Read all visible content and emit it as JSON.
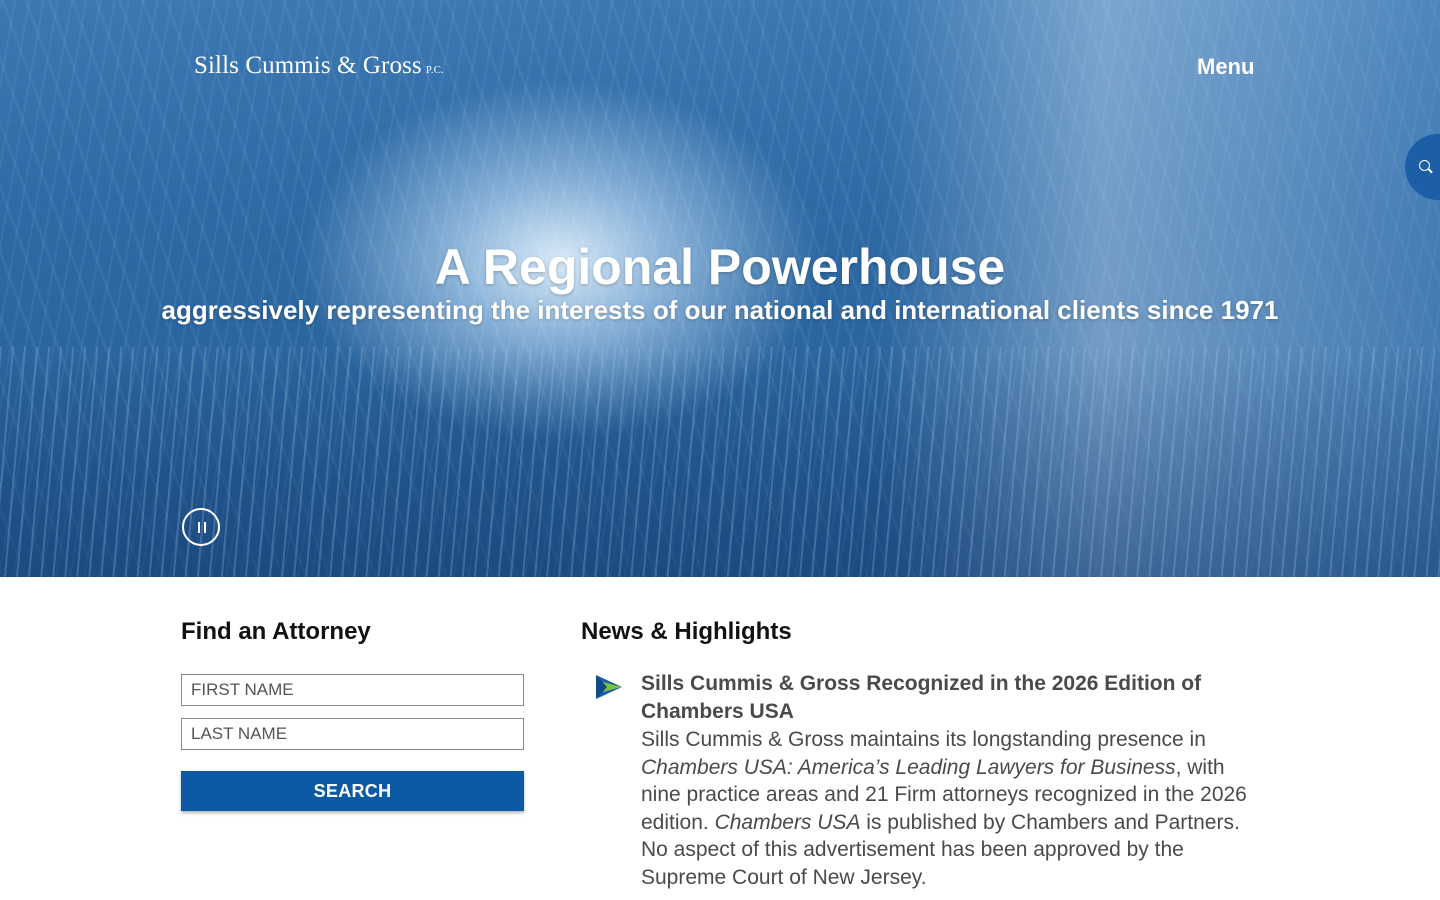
{
  "header": {
    "logo_text": "Sills Cummis & Gross",
    "logo_suffix": "P.C.",
    "menu_label": "Menu",
    "search_icon": "search-icon"
  },
  "hero": {
    "title": "A Regional Powerhouse",
    "subtitle": "aggressively representing the interests of our national and international clients since 1971",
    "pause_icon": "pause-icon"
  },
  "find_attorney": {
    "heading": "Find an Attorney",
    "first_name_placeholder": "FIRST NAME",
    "last_name_placeholder": "LAST NAME",
    "search_label": "SEARCH"
  },
  "news": {
    "heading": "News & Highlights",
    "items": [
      {
        "icon": "play-arrow-icon",
        "title": "Sills Cummis & Gross Recognized in the 2026 Edition of Chambers USA",
        "body_1": "Sills Cummis & Gross maintains its longstanding presence in ",
        "body_2": "Chambers USA: America’s Leading Lawyers for Business",
        "body_3": ", with nine practice areas and 21 Firm attorneys recognized in the 2026 edition. ",
        "body_4": "Chambers USA",
        "body_5": " is published by Chambers and Partners. No aspect of this advertisement has been approved by the Supreme Court of New Jersey."
      }
    ]
  },
  "colors": {
    "brand_blue": "#0b5aa3",
    "text_dark": "#111111",
    "text_body": "#4a4a4a",
    "arrow_green": "#7ac043",
    "arrow_blue": "#1a5fa8"
  }
}
